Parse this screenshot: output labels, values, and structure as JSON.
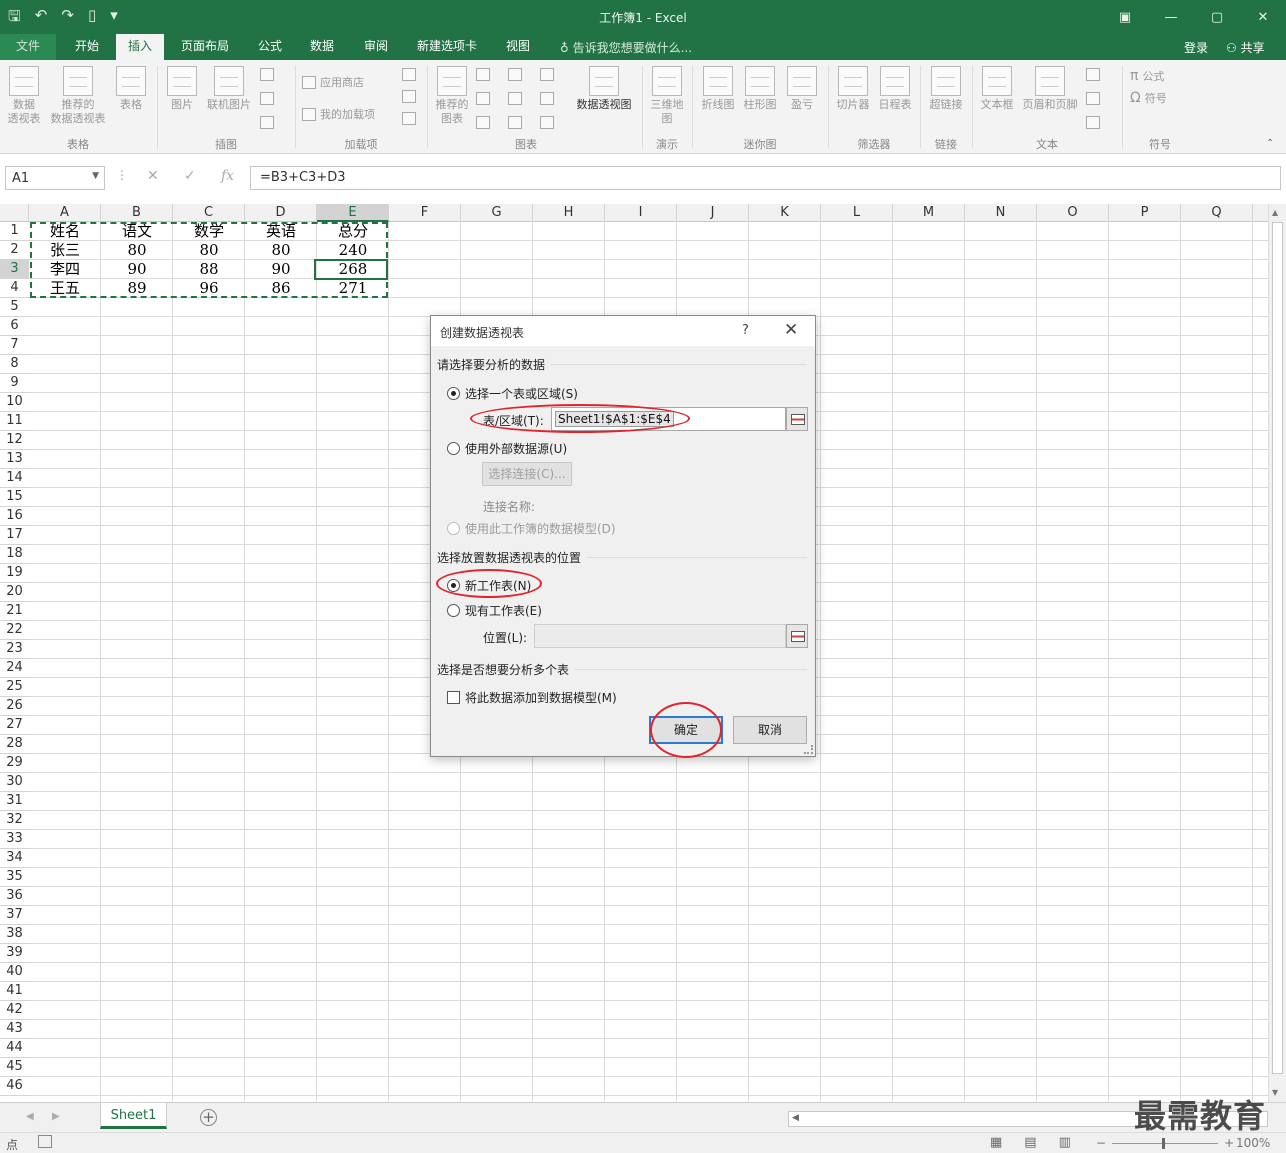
{
  "titlebar": {
    "title": "工作簿1 - Excel",
    "qat_icons": [
      "save-icon",
      "undo-icon",
      "redo-icon",
      "new-file-icon",
      "customize-icon"
    ],
    "window_controls": [
      "ribbon-display-icon",
      "minimize-icon",
      "maximize-icon",
      "close-icon"
    ]
  },
  "tabs": {
    "items": [
      "文件",
      "开始",
      "插入",
      "页面布局",
      "公式",
      "数据",
      "审阅",
      "新建选项卡",
      "视图"
    ],
    "active": "插入",
    "tell_me": "告诉我您想要做什么...",
    "login": "登录",
    "share": "共享"
  },
  "ribbon": {
    "pivot": "数据\n透视表",
    "recommended_pivot": "推荐的\n数据透视表",
    "table": "表格",
    "picture": "图片",
    "online_picture": "联机图片",
    "store": "应用商店",
    "my_addins": "我的加载项",
    "recommended_charts": "推荐的\n图表",
    "pivot_chart": "数据透视图",
    "map3d": "三维地\n图",
    "line": "折线图",
    "column": "柱形图",
    "winloss": "盈亏",
    "slicer": "切片器",
    "timeline": "日程表",
    "hyperlink": "超链接",
    "textbox": "文本框",
    "header_footer": "页眉和页脚",
    "equation": "公式",
    "symbol": "符号",
    "groups": {
      "tables": "表格",
      "illustrations": "插图",
      "addins": "加载项",
      "charts": "图表",
      "tours": "演示",
      "sparklines": "迷你图",
      "filters": "筛选器",
      "links": "链接",
      "text": "文本",
      "symbols": "符号"
    }
  },
  "formula_bar": {
    "name_box": "A1",
    "cancel": "✕",
    "enter": "✓",
    "fx": "fx",
    "formula": "=B3+C3+D3"
  },
  "grid": {
    "columns": [
      "A",
      "B",
      "C",
      "D",
      "E",
      "F",
      "G",
      "H",
      "I",
      "J",
      "K",
      "L",
      "M",
      "N",
      "O",
      "P",
      "Q"
    ],
    "selected_column": "E",
    "selected_row": 3,
    "row_count": 46,
    "cells": [
      [
        "姓名",
        "语文",
        "数学",
        "英语",
        "总分"
      ],
      [
        "张三",
        "80",
        "80",
        "80",
        "240"
      ],
      [
        "李四",
        "90",
        "88",
        "90",
        "268"
      ],
      [
        "王五",
        "89",
        "96",
        "86",
        "271"
      ]
    ]
  },
  "sheets": {
    "tabs": [
      "Sheet1"
    ],
    "active": "Sheet1",
    "add": "+"
  },
  "statusbar": {
    "status": "点",
    "zoom": "100%",
    "zoom_minus": "−",
    "zoom_plus": "+"
  },
  "watermark": "最需教育",
  "dialog": {
    "title": "创建数据透视表",
    "help": "?",
    "close": "✕",
    "section_data": "请选择要分析的数据",
    "radio_range": "选择一个表或区域(S)",
    "range_label": "表/区域(T):",
    "range_value": "Sheet1!$A$1:$E$4",
    "radio_external": "使用外部数据源(U)",
    "choose_connection": "选择连接(C)...",
    "connection_name": "连接名称:",
    "radio_model": "使用此工作簿的数据模型(D)",
    "section_location": "选择放置数据透视表的位置",
    "radio_new_sheet": "新工作表(N)",
    "radio_existing": "现有工作表(E)",
    "location_label": "位置(L):",
    "location_value": "",
    "section_multi": "选择是否想要分析多个表",
    "checkbox_model": "将此数据添加到数据模型(M)",
    "ok": "确定",
    "cancel": "取消",
    "selected_source": "range",
    "selected_location": "new_sheet",
    "add_to_model": false
  },
  "annotation_color": "#e2252d"
}
